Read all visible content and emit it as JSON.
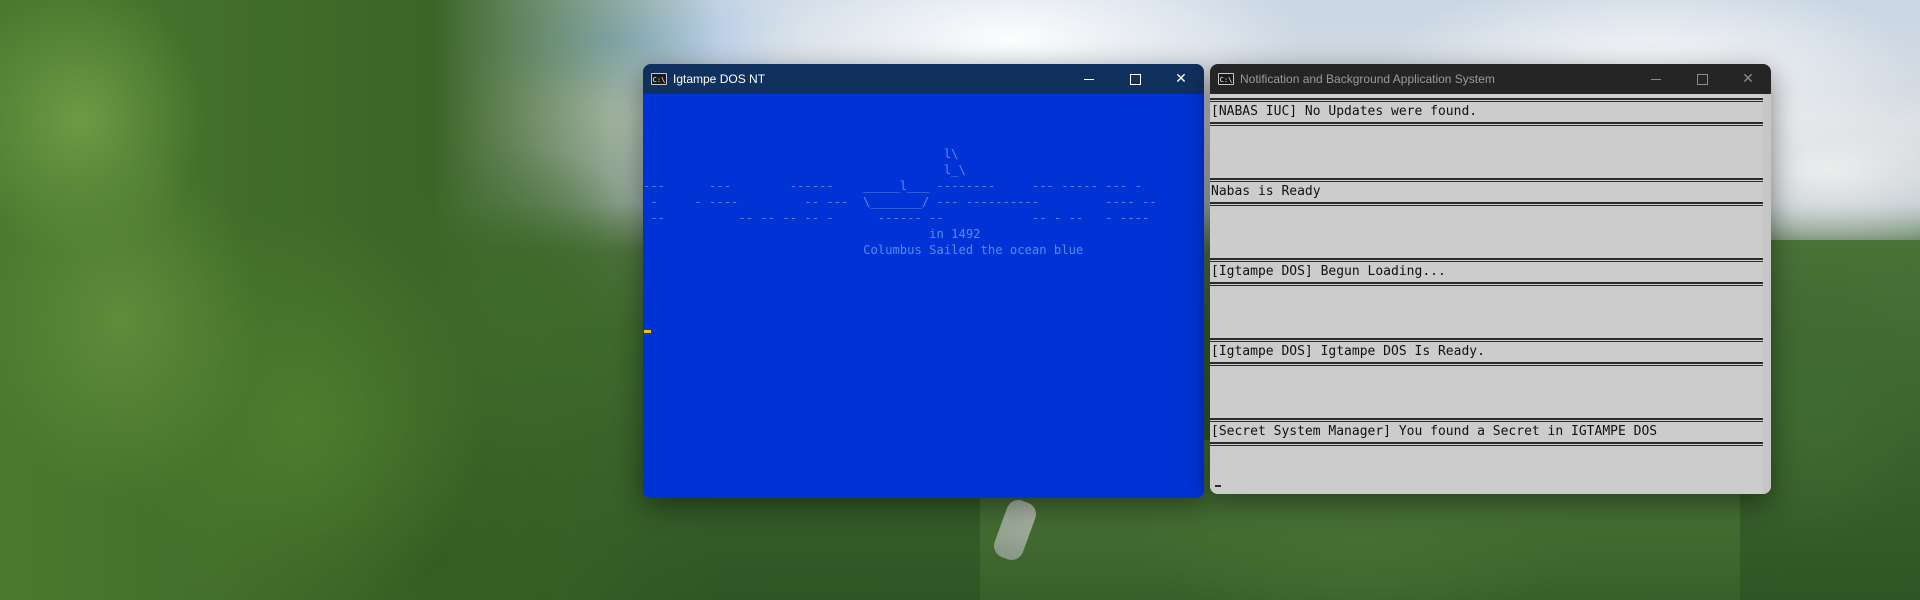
{
  "desktop": {
    "wallpaper": "forest-overlook"
  },
  "dos_window": {
    "title": "Igtampe DOS NT",
    "icon": "console-icon",
    "icon_text": "C:\\",
    "background_color": "#0033d6",
    "text_color": "#4f8fe8",
    "cursor_color": "#f2c200",
    "ascii_art": "                                         l\\\n                                         l_\\\n---      ---        ------    _____l___ --------     --- ----- --- -\n -     - ----         -- ---  \\_______/ --- ----------         ---- --\n --          -- -- -- -- -      ------ --            -- - --   - ----\n                                       in 1492\n                              Columbus Sailed the ocean blue"
  },
  "nabas_window": {
    "title": "Notification and Background Application System",
    "icon": "console-icon",
    "icon_text": "C:\\",
    "messages": [
      "[NABAS IUC] No Updates were found.",
      "Nabas is Ready",
      "[Igtampe DOS] Begun Loading...",
      "[Igtampe DOS] Igtampe DOS Is Ready.",
      "[Secret System Manager] You found a Secret in IGTAMPE DOS"
    ]
  },
  "window_controls": {
    "minimize": "minimize-icon",
    "maximize": "maximize-icon",
    "close": "close-icon",
    "close_glyph": "✕"
  }
}
